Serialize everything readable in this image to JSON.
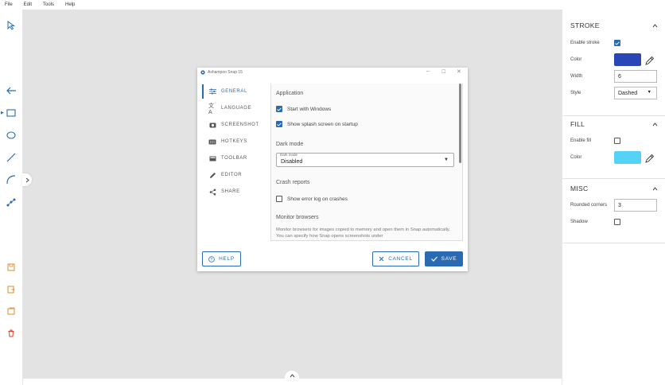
{
  "menu": [
    "File",
    "Edit",
    "Tools",
    "Help"
  ],
  "tools": [
    {
      "name": "select-tool",
      "icon": "cursor-icon"
    },
    {
      "name": "arrow-tool",
      "icon": "arrow-left-icon"
    },
    {
      "name": "rectangle-tool",
      "icon": "rectangle-icon"
    },
    {
      "name": "ellipse-tool",
      "icon": "ellipse-icon"
    },
    {
      "name": "line-tool",
      "icon": "line-icon"
    },
    {
      "name": "curve-tool",
      "icon": "curve-icon"
    },
    {
      "name": "points-tool",
      "icon": "points-icon"
    },
    {
      "name": "save-tool",
      "icon": "save-icon"
    },
    {
      "name": "export-tool",
      "icon": "export-icon"
    },
    {
      "name": "save-as-tool",
      "icon": "save-as-icon"
    },
    {
      "name": "delete-tool",
      "icon": "trash-icon"
    }
  ],
  "colors": {
    "accent": "#2a6ab2",
    "stroke_color": "#2a45b5",
    "fill_color": "#55d3f6",
    "file_tool": "#e0892b",
    "delete_tool": "#d9402f"
  },
  "right_panel": {
    "stroke": {
      "title": "STROKE",
      "enable_label": "Enable stroke",
      "enable_checked": true,
      "color_label": "Color",
      "width_label": "Width",
      "width_value": "6",
      "style_label": "Style",
      "style_value": "Dashed"
    },
    "fill": {
      "title": "FILL",
      "enable_label": "Enable fill",
      "enable_checked": false,
      "color_label": "Color"
    },
    "misc": {
      "title": "MISC",
      "rounded_label": "Rounded corners",
      "rounded_value": "3",
      "shadow_label": "Shadow",
      "shadow_checked": false
    }
  },
  "dialog": {
    "title": "Ashampoo Snap 15",
    "nav": [
      {
        "label": "GENERAL",
        "icon": "sliders-icon",
        "active": true
      },
      {
        "label": "LANGUAGE",
        "icon": "translate-icon",
        "active": false
      },
      {
        "label": "SCREENSHOT",
        "icon": "camera-icon",
        "active": false
      },
      {
        "label": "HOTKEYS",
        "icon": "keyboard-icon",
        "active": false
      },
      {
        "label": "TOOLBAR",
        "icon": "toolbar-icon",
        "active": false
      },
      {
        "label": "EDITOR",
        "icon": "pencil-icon",
        "active": false
      },
      {
        "label": "SHARE",
        "icon": "share-icon",
        "active": false
      }
    ],
    "application": {
      "title": "Application",
      "start_with_windows": "Start with Windows",
      "show_splash": "Show splash screen on startup"
    },
    "dark_mode": {
      "title": "Dark mode",
      "select_label": "Dark mode",
      "select_value": "Disabled"
    },
    "crash": {
      "title": "Crash reports",
      "show_error_log": "Show error log on crashes"
    },
    "monitor": {
      "title": "Monitor browsers",
      "description": "Monitor browsers for images copied to memory and open them in Snap automatically. You can specify how Snap opens screenshots under"
    },
    "buttons": {
      "help": "HELP",
      "cancel": "CANCEL",
      "save": "SAVE"
    }
  }
}
